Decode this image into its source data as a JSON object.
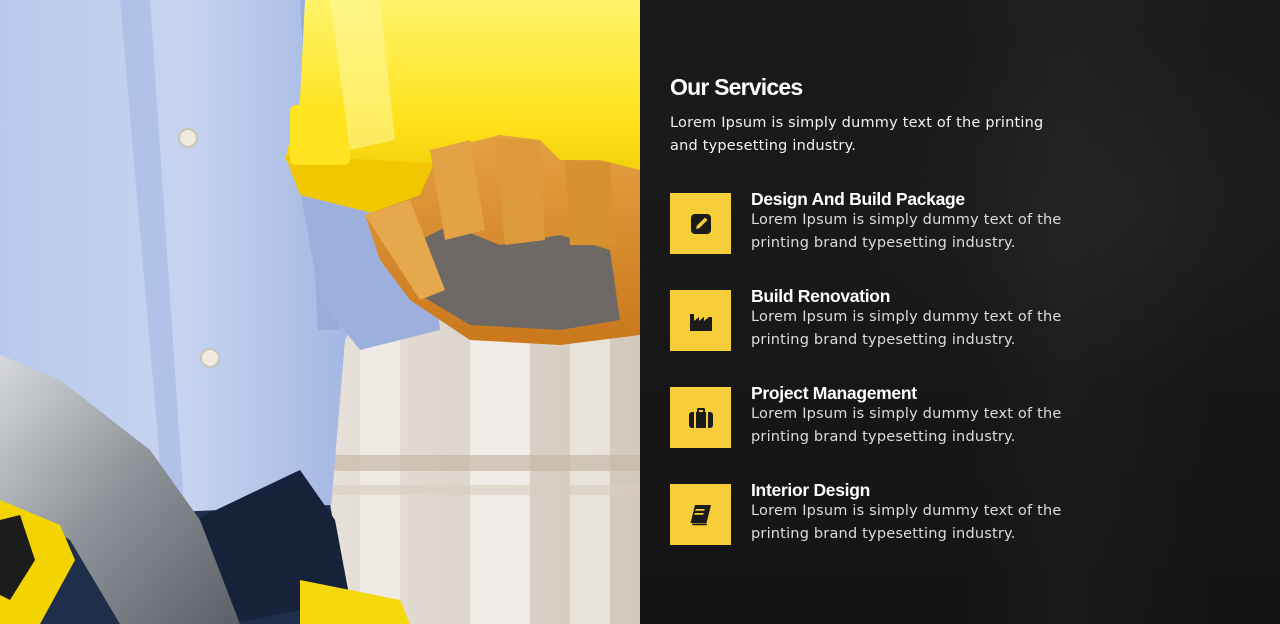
{
  "hero_image": {
    "alt": "Construction worker holding a yellow hard hat and a hammer"
  },
  "services_section": {
    "title": "Our Services",
    "intro": "Lorem Ipsum is simply dummy text of the printing and typesetting industry.",
    "accent_color": "#f7cd3a",
    "items": [
      {
        "icon": "pencil-icon",
        "name": "Design And Build Package",
        "description": "Lorem Ipsum is simply dummy text of the printing brand typesetting industry."
      },
      {
        "icon": "factory-icon",
        "name": "Build Renovation",
        "description": "Lorem Ipsum is simply dummy text of the printing brand typesetting industry."
      },
      {
        "icon": "briefcase-icon",
        "name": "Project Management",
        "description": "Lorem Ipsum is simply dummy text of the printing brand typesetting industry."
      },
      {
        "icon": "book-icon",
        "name": "Interior Design",
        "description": "Lorem Ipsum is simply dummy text of the printing brand typesetting industry."
      }
    ]
  }
}
